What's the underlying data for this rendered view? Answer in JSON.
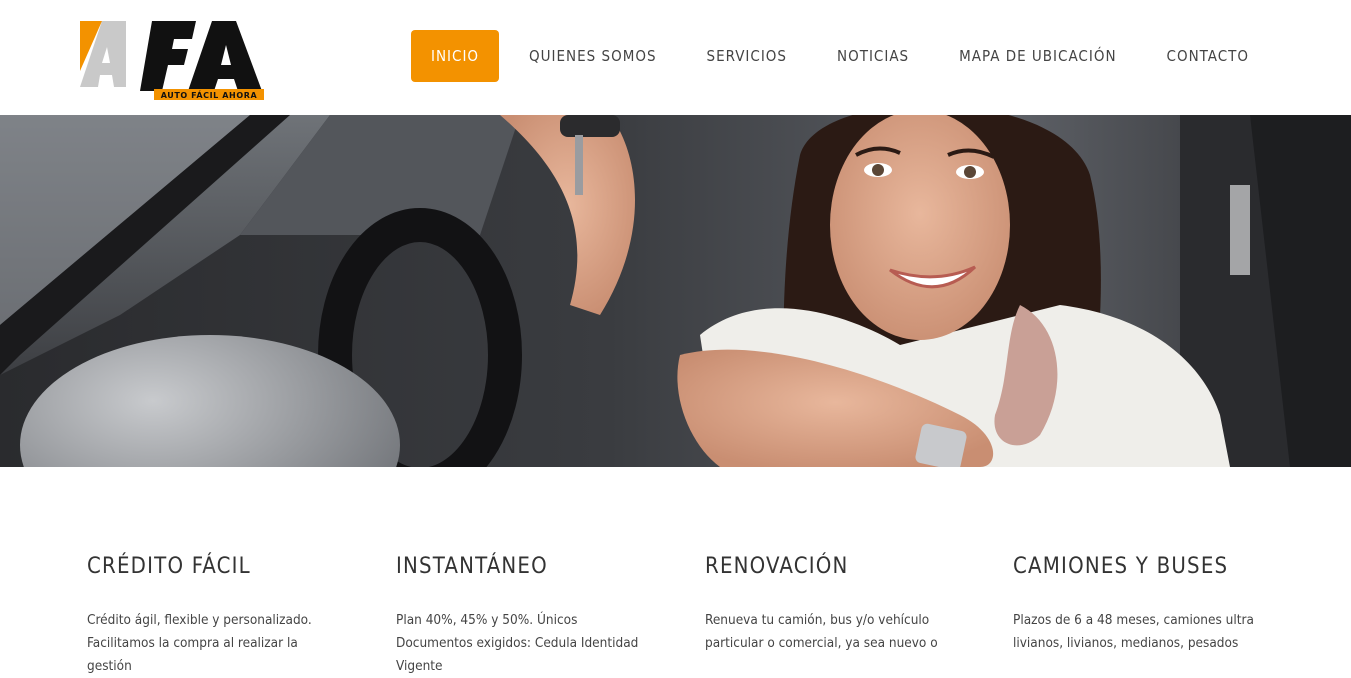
{
  "logo": {
    "letters": "AFA",
    "tagline": "AUTO FÁCIL AHORA",
    "colors": {
      "orange": "#f39200",
      "gray": "#c9c9c9",
      "black": "#111111"
    }
  },
  "nav": {
    "items": [
      {
        "label": "INICIO",
        "active": true
      },
      {
        "label": "QUIENES SOMOS",
        "active": false
      },
      {
        "label": "SERVICIOS",
        "active": false
      },
      {
        "label": "NOTICIAS",
        "active": false
      },
      {
        "label": "MAPA DE UBICACIÓN",
        "active": false
      },
      {
        "label": "CONTACTO",
        "active": false
      }
    ],
    "active_color": "#f39200"
  },
  "hero": {
    "image": "woman-in-car-holding-keys"
  },
  "features": [
    {
      "title": "CRÉDITO FÁCIL",
      "text": "Crédito ágil, flexible y personalizado. Facilitamos la compra al realizar la gestión"
    },
    {
      "title": "INSTANTÁNEO",
      "text": "Plan 40%, 45% y 50%. Únicos Documentos exigidos: Cedula Identidad Vigente"
    },
    {
      "title": "RENOVACIÓN",
      "text": "Renueva tu camión, bus y/o vehículo particular o comercial, ya sea nuevo o"
    },
    {
      "title": "CAMIONES Y BUSES",
      "text": "Plazos de 6 a 48 meses, camiones ultra livianos, livianos, medianos, pesados"
    }
  ]
}
